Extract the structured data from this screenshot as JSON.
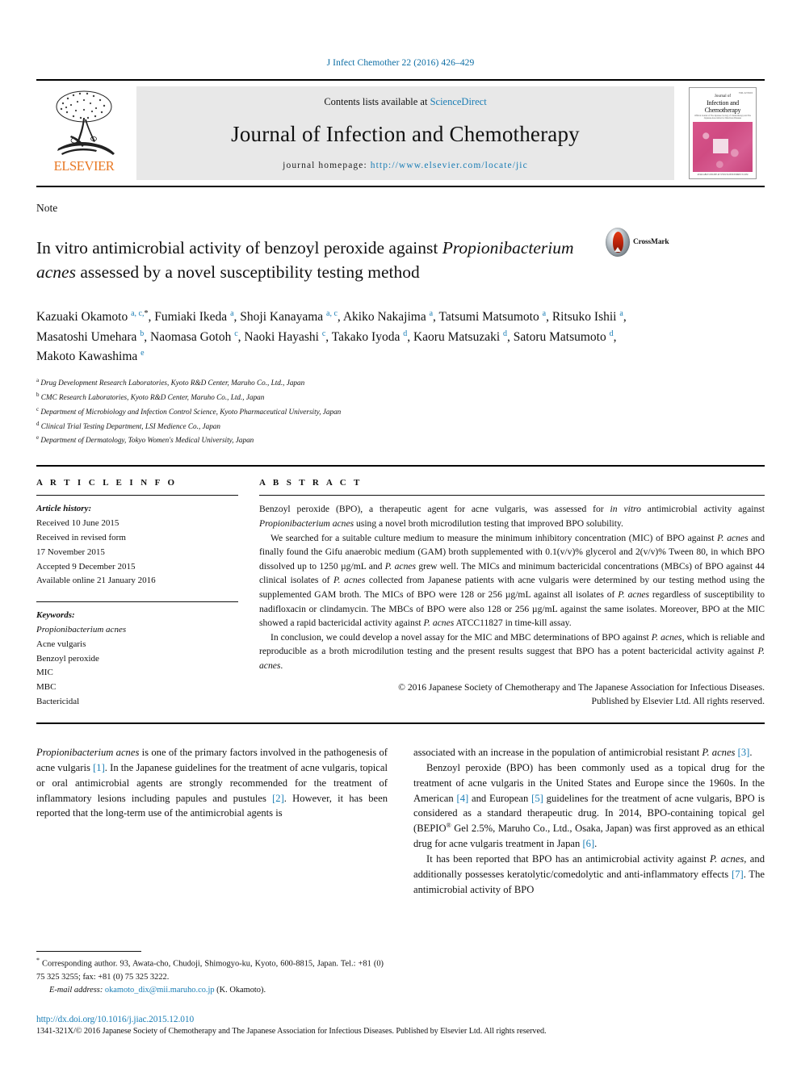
{
  "running_head": "J Infect Chemother 22 (2016) 426–429",
  "masthead": {
    "contents_prefix": "Contents lists available at ",
    "contents_link": "ScienceDirect",
    "journal_title": "Journal of Infection and Chemotherapy",
    "homepage_prefix": "journal homepage: ",
    "homepage_url": "http://www.elsevier.com/locate/jic",
    "publisher": "ELSEVIER",
    "cover": {
      "issue_tiny": "VOLUME 22 NUMBER 6\nDECEMBER 2016",
      "line1": "Journal of",
      "line2": "Infection and Chemotherapy",
      "sub": "Official Journal of The Japanese Society of Chemotherapy and The Japanese Association for Infectious Diseases",
      "foot": "AVAILABLE ONLINE AT WWW.SCIENCEDIRECT.COM"
    }
  },
  "article": {
    "type": "Note",
    "title_line1": "In vitro antimicrobial activity of benzoyl peroxide against ",
    "title_italic": "Propionibacterium acnes",
    "title_line2": " assessed by a novel susceptibility testing method",
    "crossmark_label": "CrossMark"
  },
  "authors": [
    {
      "name": "Kazuaki Okamoto",
      "sup": "a, c,",
      "star": "*",
      "sep": ", "
    },
    {
      "name": "Fumiaki Ikeda",
      "sup": "a",
      "star": "",
      "sep": ", "
    },
    {
      "name": "Shoji Kanayama",
      "sup": "a, c",
      "star": "",
      "sep": ", "
    },
    {
      "name": "Akiko Nakajima",
      "sup": "a",
      "star": "",
      "sep": ", "
    },
    {
      "name": "Tatsumi Matsumoto",
      "sup": "a",
      "star": "",
      "sep": ", "
    },
    {
      "name": "Ritsuko Ishii",
      "sup": "a",
      "star": "",
      "sep": ", "
    },
    {
      "name": "Masatoshi Umehara",
      "sup": "b",
      "star": "",
      "sep": ", "
    },
    {
      "name": "Naomasa Gotoh",
      "sup": "c",
      "star": "",
      "sep": ", "
    },
    {
      "name": "Naoki Hayashi",
      "sup": "c",
      "star": "",
      "sep": ", "
    },
    {
      "name": "Takako Iyoda",
      "sup": "d",
      "star": "",
      "sep": ", "
    },
    {
      "name": "Kaoru Matsuzaki",
      "sup": "d",
      "star": "",
      "sep": ", "
    },
    {
      "name": "Satoru Matsumoto",
      "sup": "d",
      "star": "",
      "sep": ", "
    },
    {
      "name": "Makoto Kawashima",
      "sup": "e",
      "star": "",
      "sep": ""
    }
  ],
  "affiliations": [
    {
      "label": "a",
      "text": "Drug Development Research Laboratories, Kyoto R&D Center, Maruho Co., Ltd., Japan"
    },
    {
      "label": "b",
      "text": "CMC Research Laboratories, Kyoto R&D Center, Maruho Co., Ltd., Japan"
    },
    {
      "label": "c",
      "text": "Department of Microbiology and Infection Control Science, Kyoto Pharmaceutical University, Japan"
    },
    {
      "label": "d",
      "text": "Clinical Trial Testing Department, LSI Medience Co., Japan"
    },
    {
      "label": "e",
      "text": "Department of Dermatology, Tokyo Women's Medical University, Japan"
    }
  ],
  "article_info": {
    "heading": "A R T I C L E   I N F O",
    "history_label": "Article history:",
    "history": [
      "Received 10 June 2015",
      "Received in revised form",
      "17 November 2015",
      "Accepted 9 December 2015",
      "Available online 21 January 2016"
    ],
    "keywords_label": "Keywords:",
    "keywords": [
      "Propionibacterium acnes",
      "Acne vulgaris",
      "Benzoyl peroxide",
      "MIC",
      "MBC",
      "Bactericidal"
    ]
  },
  "abstract": {
    "heading": "A B S T R A C T",
    "p1_a": "Benzoyl peroxide (BPO), a therapeutic agent for acne vulgaris, was assessed for ",
    "p1_it1": "in vitro",
    "p1_b": " antimicrobial activity against ",
    "p1_it2": "Propionibacterium acnes",
    "p1_c": " using a novel broth microdilution testing that improved BPO solubility.",
    "p2_a": "We searched for a suitable culture medium to measure the minimum inhibitory concentration (MIC) of BPO against ",
    "p2_it1": "P. acnes",
    "p2_b": " and finally found the Gifu anaerobic medium (GAM) broth supplemented with 0.1(v/v)% glycerol and 2(v/v)% Tween 80, in which BPO dissolved up to 1250 µg/mL and ",
    "p2_it2": "P. acnes",
    "p2_c": " grew well. The MICs and minimum bactericidal concentrations (MBCs) of BPO against 44 clinical isolates of ",
    "p2_it3": "P. acnes",
    "p2_d": " collected from Japanese patients with acne vulgaris were determined by our testing method using the supplemented GAM broth. The MICs of BPO were 128 or 256 µg/mL against all isolates of ",
    "p2_it4": "P. acnes",
    "p2_e": " regardless of susceptibility to nadifloxacin or clindamycin. The MBCs of BPO were also 128 or 256 µg/mL against the same isolates. Moreover, BPO at the MIC showed a rapid bactericidal activity against ",
    "p2_it5": "P. acnes",
    "p2_f": " ATCC11827 in time-kill assay.",
    "p3_a": "In conclusion, we could develop a novel assay for the MIC and MBC determinations of BPO against ",
    "p3_it1": "P. acnes",
    "p3_b": ", which is reliable and reproducible as a broth microdilution testing and the present results suggest that BPO has a potent bactericidal activity against ",
    "p3_it2": "P. acnes",
    "p3_c": ".",
    "copyright_line1": "© 2016 Japanese Society of Chemotherapy and The Japanese Association for Infectious Diseases.",
    "copyright_line2": "Published by Elsevier Ltd. All rights reserved."
  },
  "body": {
    "left": {
      "p1_it": "Propionibacterium acnes",
      "p1_a": " is one of the primary factors involved in the pathogenesis of acne vulgaris ",
      "p1_r1": "[1]",
      "p1_b": ". In the Japanese guidelines for the treatment of acne vulgaris, topical or oral antimicrobial agents are strongly recommended for the treatment of inflammatory lesions including papules and pustules ",
      "p1_r2": "[2]",
      "p1_c": ". However, it has been reported that the long-term use of the antimicrobial agents is"
    },
    "right": {
      "p1_a": "associated with an increase in the population of antimicrobial resistant ",
      "p1_it": "P. acnes",
      "p1_r": "[3]",
      "p1_b": ".",
      "p2_a": "Benzoyl peroxide (BPO) has been commonly used as a topical drug for the treatment of acne vulgaris in the United States and Europe since the 1960s. In the American ",
      "p2_r1": "[4]",
      "p2_b": " and European ",
      "p2_r2": "[5]",
      "p2_c": " guidelines for the treatment of acne vulgaris, BPO is considered as a standard therapeutic drug. In 2014, BPO-containing topical gel (BEPIO",
      "p2_reg": "®",
      "p2_d": " Gel 2.5%, Maruho Co., Ltd., Osaka, Japan) was first approved as an ethical drug for acne vulgaris treatment in Japan ",
      "p2_r3": "[6]",
      "p2_e": ".",
      "p3_a": "It has been reported that BPO has an antimicrobial activity against ",
      "p3_it": "P. acnes",
      "p3_b": ", and additionally possesses keratolytic/comedolytic and anti-inflammatory effects ",
      "p3_r": "[7]",
      "p3_c": ". The antimicrobial activity of BPO"
    }
  },
  "footnote": {
    "star": "*",
    "text": " Corresponding author. 93, Awata-cho, Chudoji, Shimogyo-ku, Kyoto, 600-8815, Japan. Tel.: +81 (0) 75 325 3255; fax: +81 (0) 75 325 3222.",
    "email_label": "E-mail address:",
    "email": "okamoto_dix@mii.maruho.co.jp",
    "email_suffix": " (K. Okamoto)."
  },
  "bottom": {
    "doi": "http://dx.doi.org/10.1016/j.jiac.2015.12.010",
    "issn": "1341-321X/© 2016 Japanese Society of Chemotherapy and The Japanese Association for Infectious Diseases. Published by Elsevier Ltd. All rights reserved."
  },
  "colors": {
    "link": "#1a7db5",
    "elsevier_orange": "#E87722",
    "cover_pink": "#cf4b82"
  }
}
